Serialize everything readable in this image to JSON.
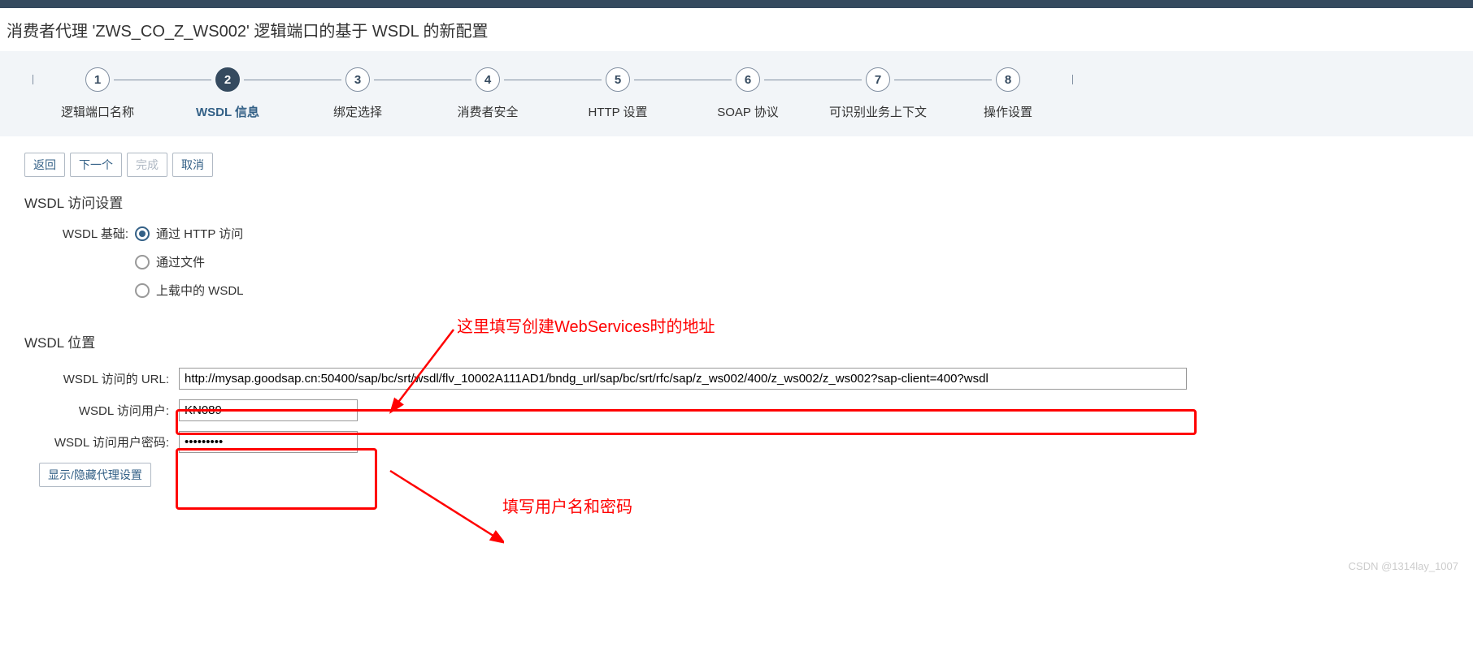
{
  "pageTitle": "消费者代理 'ZWS_CO_Z_WS002' 逻辑端口的基于 WSDL 的新配置",
  "steps": [
    {
      "num": "1",
      "label": "逻辑端口名称"
    },
    {
      "num": "2",
      "label": "WSDL 信息"
    },
    {
      "num": "3",
      "label": "绑定选择"
    },
    {
      "num": "4",
      "label": "消费者安全"
    },
    {
      "num": "5",
      "label": "HTTP 设置"
    },
    {
      "num": "6",
      "label": "SOAP 协议"
    },
    {
      "num": "7",
      "label": "可识别业务上下文"
    },
    {
      "num": "8",
      "label": "操作设置"
    }
  ],
  "activeStep": 2,
  "buttons": {
    "back": "返回",
    "next": "下一个",
    "finish": "完成",
    "cancel": "取消"
  },
  "sections": {
    "accessSettings": "WSDL 访问设置",
    "wsdlLocation": "WSDL 位置"
  },
  "wsdlBase": {
    "label": "WSDL 基础:",
    "options": [
      {
        "text": "通过 HTTP 访问",
        "selected": true
      },
      {
        "text": "通过文件",
        "selected": false
      },
      {
        "text": "上载中的 WSDL",
        "selected": false
      }
    ]
  },
  "fields": {
    "urlLabel": "WSDL 访问的 URL:",
    "urlValue": "http://mysap.goodsap.cn:50400/sap/bc/srt/wsdl/flv_10002A111AD1/bndg_url/sap/bc/srt/rfc/sap/z_ws002/400/z_ws002/z_ws002?sap-client=400?wsdl",
    "userLabel": "WSDL 访问用户:",
    "userValue": "KN089",
    "passLabel": "WSDL 访问用户密码:",
    "passValue": "•••••••••",
    "proxyToggle": "显示/隐藏代理设置"
  },
  "annotations": {
    "a1": "这里填写创建WebServices时的地址",
    "a2": "填写用户名和密码"
  },
  "watermark": "CSDN @1314lay_1007"
}
